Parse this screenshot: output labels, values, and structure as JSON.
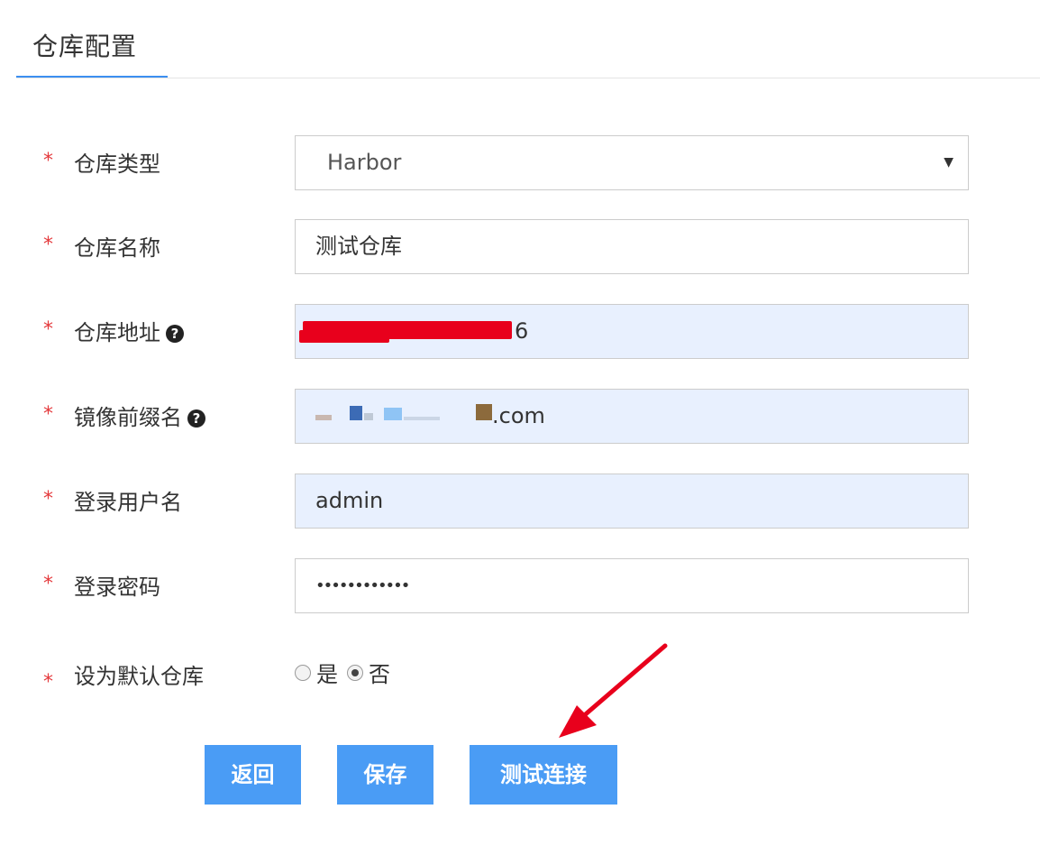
{
  "tab": {
    "title": "仓库配置"
  },
  "form": {
    "required_mark": "*",
    "type": {
      "label": "仓库类型",
      "value": "Harbor"
    },
    "name": {
      "label": "仓库名称",
      "value": "测试仓库"
    },
    "address": {
      "label": "仓库地址",
      "value": "6"
    },
    "prefix": {
      "label": "镜像前缀名",
      "value": ".com"
    },
    "username": {
      "label": "登录用户名",
      "value": "admin"
    },
    "password": {
      "label": "登录密码",
      "value": "••••••••••••"
    },
    "default": {
      "label": "设为默认仓库",
      "option_yes": "是",
      "option_no": "否",
      "selected": "否"
    }
  },
  "buttons": {
    "back": "返回",
    "save": "保存",
    "test": "测试连接"
  },
  "colors": {
    "accent": "#3c8ff0",
    "button": "#4a9cf5",
    "required": "#e4393c",
    "arrow": "#e8001c"
  }
}
